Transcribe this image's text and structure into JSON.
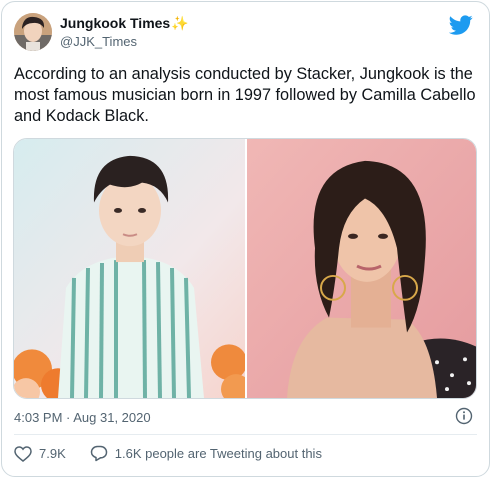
{
  "author": {
    "name": "Jungkook Times",
    "handle": "@JJK_Times",
    "emoji": "✨"
  },
  "tweet": {
    "text": "According to an analysis conducted by Stacker, Jungkook is the most famous musician born in 1997 followed by Camilla Cabello and Kodack Black."
  },
  "meta": {
    "timestamp": "4:03 PM · Aug 31, 2020"
  },
  "stats": {
    "likes": "7.9K",
    "tweeting": "1.6K people are Tweeting about this"
  },
  "icons": {
    "brand": "twitter-bird-icon",
    "info": "info-icon",
    "like": "heart-icon",
    "reply": "speech-bubble-icon"
  },
  "colors": {
    "brand": "#1d9bf0",
    "text": "#0f1419",
    "muted": "#536471",
    "sparkle": "#f4c23b"
  }
}
